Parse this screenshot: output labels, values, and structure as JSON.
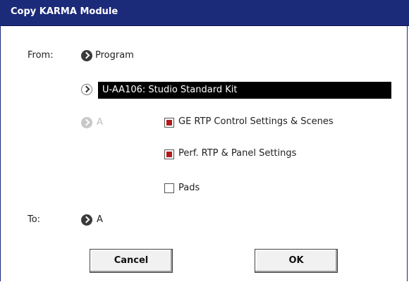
{
  "dialog": {
    "title": "Copy KARMA Module"
  },
  "from": {
    "label": "From:",
    "source_type": "Program",
    "program_name": "U-AA106: Studio Standard Kit",
    "module": "A"
  },
  "options": [
    {
      "label": "GE RTP Control Settings & Scenes",
      "checked": true
    },
    {
      "label": "Perf. RTP & Panel Settings",
      "checked": true
    },
    {
      "label": "Pads",
      "checked": false
    }
  ],
  "to": {
    "label": "To:",
    "module": "A"
  },
  "buttons": {
    "cancel": "Cancel",
    "ok": "OK"
  },
  "colors": {
    "titlebar": "#1c2a7a",
    "check_fill": "#b41a1a"
  }
}
